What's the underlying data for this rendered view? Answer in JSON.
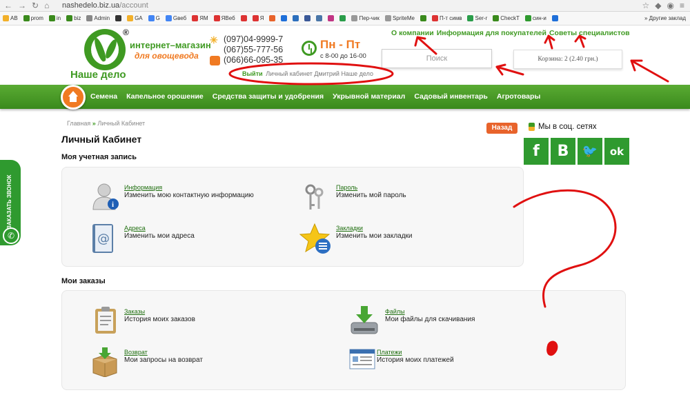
{
  "browser": {
    "url_host": "nashedelo.biz.ua",
    "url_path": "/account",
    "bookmarks": [
      {
        "label": "AB",
        "color": "#f2b02a"
      },
      {
        "label": "prom",
        "color": "#3a8a1c"
      },
      {
        "label": "in",
        "color": "#3a8a1c"
      },
      {
        "label": "biz",
        "color": "#3a8a1c"
      },
      {
        "label": "Admin",
        "color": "#888888"
      },
      {
        "label": "",
        "color": "#333333"
      },
      {
        "label": "GA",
        "color": "#f2b02a"
      },
      {
        "label": "G",
        "color": "#4285f4"
      },
      {
        "label": "Gвеб",
        "color": "#4285f4"
      },
      {
        "label": "ЯМ",
        "color": "#d33"
      },
      {
        "label": "ЯВеб",
        "color": "#d33"
      },
      {
        "label": "",
        "color": "#d33"
      },
      {
        "label": "Я",
        "color": "#d33"
      },
      {
        "label": "",
        "color": "#e8632b"
      },
      {
        "label": "",
        "color": "#1e6fd9"
      },
      {
        "label": "",
        "color": "#2c6fbd"
      },
      {
        "label": "",
        "color": "#3b5998"
      },
      {
        "label": "",
        "color": "#4a76a8"
      },
      {
        "label": "",
        "color": "#c13584"
      },
      {
        "label": "",
        "color": "#2a9d4a"
      },
      {
        "label": "Пер-чик",
        "color": "#999999"
      },
      {
        "label": "SpriteMe",
        "color": "#999999"
      },
      {
        "label": "",
        "color": "#3a8a1c"
      },
      {
        "label": "П-т симв",
        "color": "#d33"
      },
      {
        "label": "Ser-r",
        "color": "#2a9d4a"
      },
      {
        "label": "CheckT",
        "color": "#3a8a1c"
      },
      {
        "label": "син-и",
        "color": "#2f9a2f"
      },
      {
        "label": "",
        "color": "#1e6fd9"
      }
    ],
    "bookmarks_more": "»",
    "other_bookmarks": "Другие заклад"
  },
  "header": {
    "logo": {
      "reg": "®",
      "shop": "интернет–магазин",
      "sub": "для овощевода",
      "brand": "Наше дело"
    },
    "phones": [
      "(097)04-9999-7",
      "(067)55-777-56",
      "(066)66-095-35"
    ],
    "schedule": {
      "days": "Пн - Пт",
      "hours": "с 8-00 до 16-00"
    },
    "top_links": [
      "О компании",
      "Информация для покупателей",
      "Советы специалистов"
    ],
    "search_placeholder": "Поиск",
    "cart": "Корзина: 2 (2.40 грн.)",
    "user": {
      "exit": "Выйти",
      "cabinet": "Личный кабинет",
      "name": "Дмитрий",
      "site": "Наше дело"
    }
  },
  "nav": {
    "items": [
      "Семена",
      "Капельное орошение",
      "Средства защиты и удобрения",
      "Укрывной материал",
      "Садовый инвентарь",
      "Агротовары"
    ]
  },
  "page": {
    "breadcrumb": {
      "home": "Главная",
      "sep": "»",
      "current": "Личный Кабинет"
    },
    "title": "Личный Кабинет",
    "back": "Назад",
    "social_title": "Мы в соц. сетях",
    "socials": [
      "f",
      "B",
      "🐦",
      "ok"
    ],
    "account_heading": "Моя учетная запись",
    "account_items": [
      {
        "link": "Информация",
        "text": "Изменить мою контактную информацию",
        "icon": "user-info-icon"
      },
      {
        "link": "Пароль",
        "text": "Изменить мой пароль",
        "icon": "keys-icon"
      },
      {
        "link": "Адреса",
        "text": "Изменить мои адреса",
        "icon": "address-book-icon"
      },
      {
        "link": "Закладки",
        "text": "Изменить мои закладки",
        "icon": "star-bookmark-icon"
      }
    ],
    "orders_heading": "Мои заказы",
    "orders_items": [
      {
        "link": "Заказы",
        "text": "История моих заказов",
        "icon": "clipboard-icon"
      },
      {
        "link": "Файлы",
        "text": "Мои файлы для скачивания",
        "icon": "download-drive-icon"
      },
      {
        "link": "Возврат",
        "text": "Мои запросы на возврат",
        "icon": "return-box-icon"
      },
      {
        "link": "Платежи",
        "text": "История моих платежей",
        "icon": "payments-icon"
      }
    ],
    "callback": "ЗАКАЗАТЬ ЗВОНОК"
  },
  "annotations": {
    "color": "#e01010"
  }
}
